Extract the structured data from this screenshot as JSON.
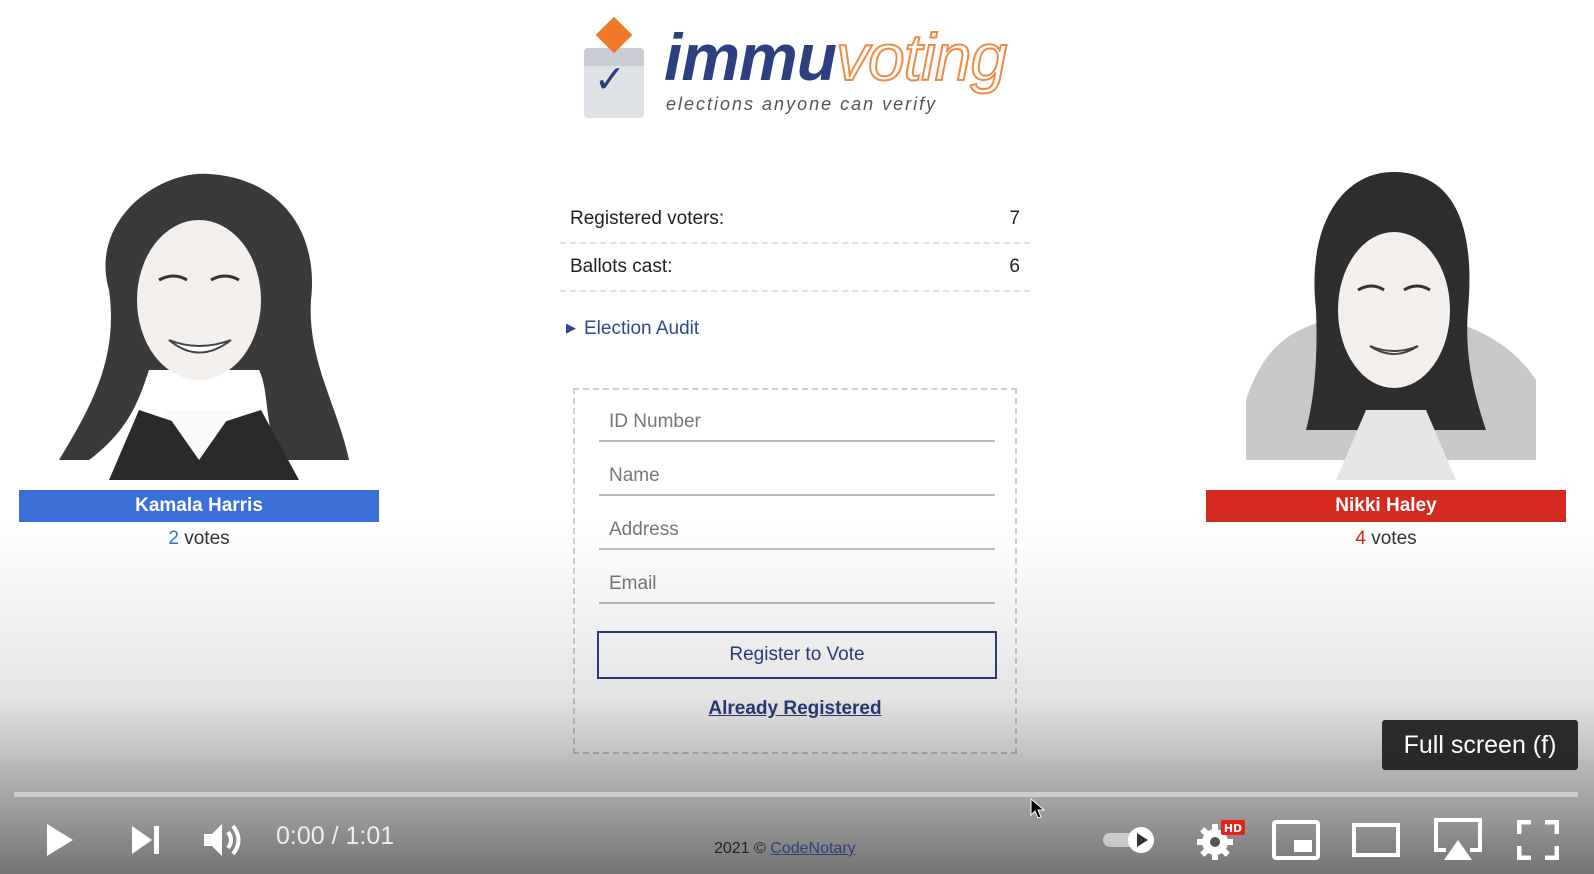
{
  "logo": {
    "word_immu": "immu",
    "word_voting": "voting",
    "tagline": "elections anyone can verify"
  },
  "candidates": [
    {
      "name": "Kamala Harris",
      "votes": "2",
      "votes_label": "votes",
      "color": "#3a6fd8"
    },
    {
      "name": "Nikki Haley",
      "votes": "4",
      "votes_label": "votes",
      "color": "#d42a1f"
    }
  ],
  "stats": [
    {
      "label": "Registered voters:",
      "value": "7"
    },
    {
      "label": "Ballots cast:",
      "value": "6"
    }
  ],
  "audit": {
    "label": "Election Audit"
  },
  "form": {
    "id_placeholder": "ID Number",
    "name_placeholder": "Name",
    "address_placeholder": "Address",
    "email_placeholder": "Email",
    "register_label": "Register to Vote",
    "already_label": "Already Registered"
  },
  "footer": {
    "copyright": "2021 ©",
    "link": "CodeNotary"
  },
  "player": {
    "time_current": "0:00",
    "time_separator": "/",
    "time_total": "1:01",
    "tooltip": "Full screen (f)",
    "progress": 0,
    "settings_badge": "HD",
    "icons": [
      "play-icon",
      "next-icon",
      "volume-icon",
      "autoplay-toggle-icon",
      "settings-icon",
      "miniplayer-icon",
      "theater-mode-icon",
      "airplay-icon",
      "fullscreen-icon"
    ]
  },
  "colors": {
    "accent_blue": "#2e3f80",
    "orange": "#f07a2a",
    "democrat": "#3a6fd8",
    "republican": "#d42a1f"
  }
}
